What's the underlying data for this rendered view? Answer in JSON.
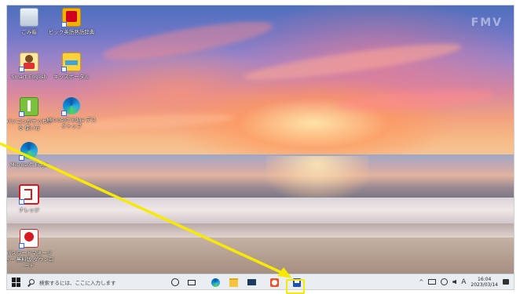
{
  "watermark": "FMV",
  "desktop_icons": [
    {
      "label": "ごみ箱",
      "icon": "recycle-bin-icon"
    },
    {
      "label": "ビック英語熟語辞典",
      "icon": "eiken-book-icon"
    },
    {
      "label": "Smart English",
      "icon": "smart-english-icon"
    },
    {
      "label": "キッズポータル",
      "icon": "kids-portal-icon"
    },
    {
      "label": "パソコンがすぐわかる 使い方",
      "icon": "guide-icon"
    },
    {
      "label": "Microsoft Edge デスクトップ",
      "icon": "edge-icon"
    },
    {
      "label": "Microsoft Edge",
      "icon": "edge-icon"
    },
    {
      "label": "ナレッジ",
      "icon": "red-app-icon"
    },
    {
      "label": "パスワードマネージャー 無料版 ダウンロード",
      "icon": "password-manager-icon"
    }
  ],
  "taskbar": {
    "start_icon": "windows-start-icon",
    "search_placeholder": "検索するには、ここに入力します",
    "pinned": [
      "cortana-icon",
      "task-view-icon",
      "edge-icon",
      "file-explorer-icon",
      "mail-icon",
      "app-orange-icon",
      "app-blue-highlighted-icon"
    ],
    "tray_ime": "A",
    "clock_time": "16:04",
    "clock_date": "2023/03/14",
    "notification_icon": "notification-icon"
  },
  "colors": {
    "annotation": "#f7ea00",
    "taskbar_bg": "#e9eef3"
  }
}
